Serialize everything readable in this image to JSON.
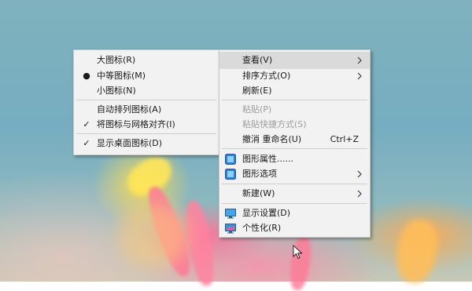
{
  "left_menu": {
    "items": [
      {
        "label": "大图标(R)",
        "mark": ""
      },
      {
        "label": "中等图标(M)",
        "mark": "●"
      },
      {
        "label": "小图标(N)",
        "mark": ""
      },
      {
        "label": "自动排列图标(A)",
        "mark": ""
      },
      {
        "label": "将图标与网格对齐(I)",
        "mark": "✓"
      },
      {
        "label": "显示桌面图标(D)",
        "mark": "✓"
      }
    ]
  },
  "main_menu": {
    "view": "查看(V)",
    "sort": "排序方式(O)",
    "refresh": "刷新(E)",
    "paste": "粘贴(P)",
    "paste_shortcut": "粘贴快捷方式(S)",
    "undo_rename": "撤消 重命名(U)",
    "undo_shortcut": "Ctrl+Z",
    "graphics_properties": "图形属性......",
    "graphics_options": "图形选项",
    "new": "新建(W)",
    "display_settings": "显示设置(D)",
    "personalize": "个性化(R)"
  },
  "icons": {
    "graphics_properties": "intel-graphics-icon",
    "graphics_options": "intel-graphics-icon",
    "display_settings": "monitor-icon",
    "personalize": "personalize-monitor-icon",
    "submenu_arrow": "chevron-right-icon"
  }
}
